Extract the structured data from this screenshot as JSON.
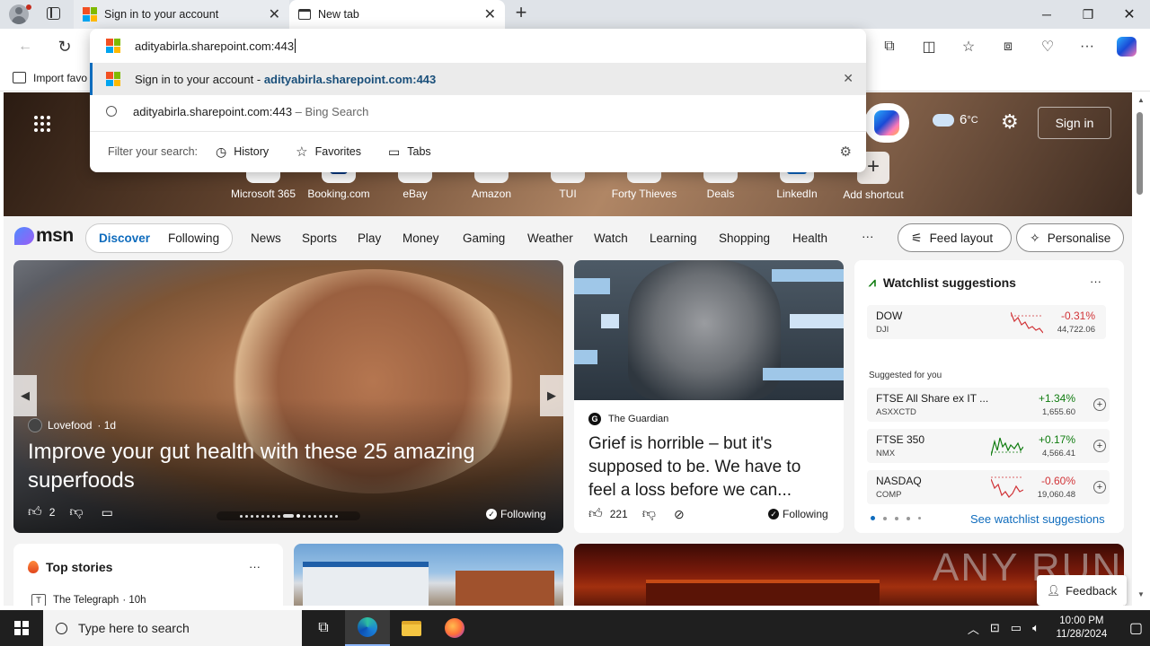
{
  "browser": {
    "tabs": [
      {
        "title": "Sign in to your account"
      },
      {
        "title": "New tab"
      }
    ],
    "address_value": "adityabirla.sharepoint.com:443",
    "favbar_label": "Import favo"
  },
  "omnibox": {
    "suggestion_1_title": "Sign in to your account",
    "suggestion_1_sep": " - ",
    "suggestion_1_url": "adityabirla.sharepoint.com:443",
    "suggestion_2_query": "adityabirla.sharepoint.com:443",
    "suggestion_2_suffix": " – Bing Search",
    "filter_label": "Filter your search:",
    "filters": [
      "History",
      "Favorites",
      "Tabs"
    ]
  },
  "hero": {
    "weather_temp": "6",
    "weather_unit": "°C",
    "sign_in": "Sign in",
    "shortcuts": [
      "Microsoft 365",
      "Booking.com",
      "eBay",
      "Amazon",
      "TUI",
      "Forty Thieves",
      "Deals",
      "LinkedIn",
      "Add shortcut"
    ]
  },
  "msn": {
    "logo": "msn",
    "tabs": [
      "Discover",
      "Following"
    ],
    "nav": [
      "News",
      "Sports",
      "Play",
      "Money",
      "Gaming",
      "Weather",
      "Watch",
      "Learning",
      "Shopping",
      "Health"
    ],
    "more": "···",
    "feed_layout": "Feed layout",
    "personalise": "Personalise"
  },
  "main_card": {
    "source": "Lovefood",
    "age": "· 1d",
    "headline": "Improve your gut health with these 25 amazing superfoods",
    "likes": "2",
    "following": "Following"
  },
  "guardian_card": {
    "source": "The Guardian",
    "headline": "Grief is horrible – but it's supposed to be. We have to feel a loss before we can...",
    "likes": "221",
    "following": "Following"
  },
  "watchlist": {
    "title": "Watchlist suggestions",
    "more": "···",
    "suggested_label": "Suggested for you",
    "see_more": "See watchlist suggestions",
    "rows": [
      {
        "name": "DOW",
        "symbol": "DJI",
        "change": "-0.31%",
        "value": "44,722.06",
        "color": "#d13438"
      },
      {
        "name": "FTSE All Share ex IT ...",
        "symbol": "ASXXCTD",
        "change": "+1.34%",
        "value": "1,655.60",
        "color": "#107c10"
      },
      {
        "name": "FTSE 350",
        "symbol": "NMX",
        "change": "+0.17%",
        "value": "4,566.41",
        "color": "#107c10"
      },
      {
        "name": "NASDAQ",
        "symbol": "COMP",
        "change": "-0.60%",
        "value": "19,060.48",
        "color": "#d13438"
      }
    ]
  },
  "top_stories": {
    "title": "Top stories",
    "more": "···",
    "first_source": "The Telegraph",
    "first_age": "· 10h"
  },
  "feedback": "Feedback",
  "watermark": "ANY RUN",
  "taskbar": {
    "search_placeholder": "Type here to search",
    "time": "10:00 PM",
    "date": "11/28/2024"
  },
  "colors": {
    "accent": "#0f6cbd",
    "taskbar": "#1f1f1f",
    "url_bold": "#1a4f7a"
  }
}
